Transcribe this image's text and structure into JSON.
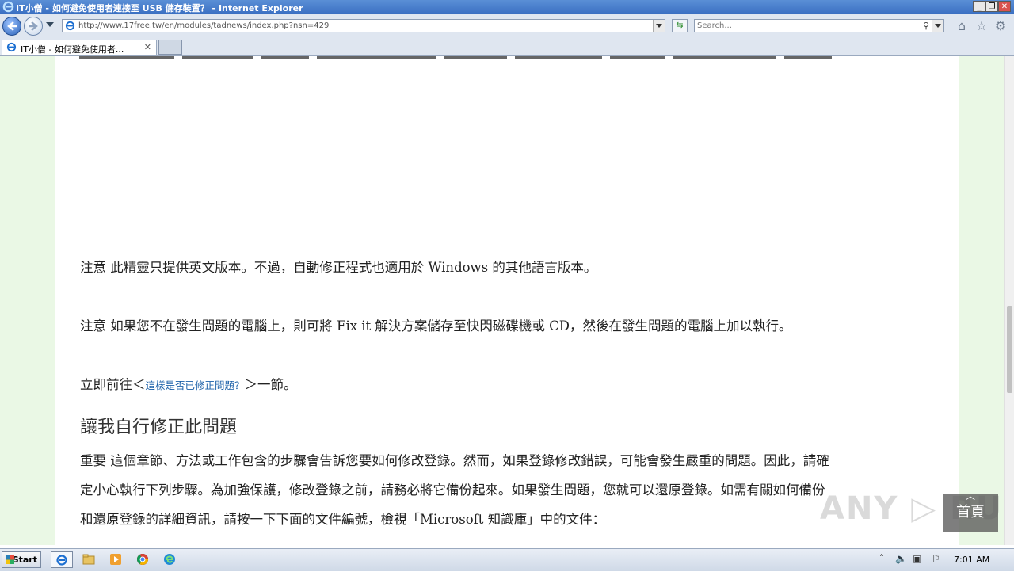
{
  "window": {
    "title": "IT小僧 - 如何避免使用者連接至 USB 儲存裝置？ - Internet Explorer",
    "minimize": "_",
    "restore": "❐",
    "close": "✕"
  },
  "navbar": {
    "url": "http://www.17free.tw/en/modules/tadnews/index.php?nsn=429",
    "search_placeholder": "Search...",
    "go_symbol": "⇆"
  },
  "tabs": [
    {
      "label": "IT小僧 - 如何避免使用者...",
      "close": "✕"
    }
  ],
  "content": {
    "note1": "注意 此精靈只提供英文版本。不過，自動修正程式也適用於 Windows 的其他語言版本。",
    "note2": "注意 如果您不在發生問題的電腦上，則可將 Fix it 解決方案儲存至快閃磁碟機或 CD，然後在發生問題的電腦上加以執行。",
    "goto_prefix": "立即前往＜",
    "goto_link": "這樣是否已修正問題？",
    "goto_suffix": "＞一節。",
    "heading": "讓我自行修正此問題",
    "important_line1": "重要 這個章節、方法或工作包含的步驟會告訴您要如何修改登錄。然而，如果登錄修改錯誤，可能會發生嚴重的問題。因此，請確",
    "important_line2": "定小心執行下列步驟。為加強保護，修改登錄之前，請務必將它備份起來。如果發生問題，您就可以還原登錄。如需有關如何備份",
    "important_line3": "和還原登錄的詳細資訊，請按一下下面的文件編號，檢視「Microsoft 知識庫」中的文件："
  },
  "overlay": {
    "home_label": "首頁",
    "up_arrow": "︿",
    "watermark": "ANY ▷ RUN"
  },
  "taskbar": {
    "start_label": "Start",
    "clock": "7:01 AM"
  },
  "colors": {
    "link": "#1a5fa8",
    "page_bg": "#eaf8e5",
    "titlebar": "#3a6fc2"
  }
}
